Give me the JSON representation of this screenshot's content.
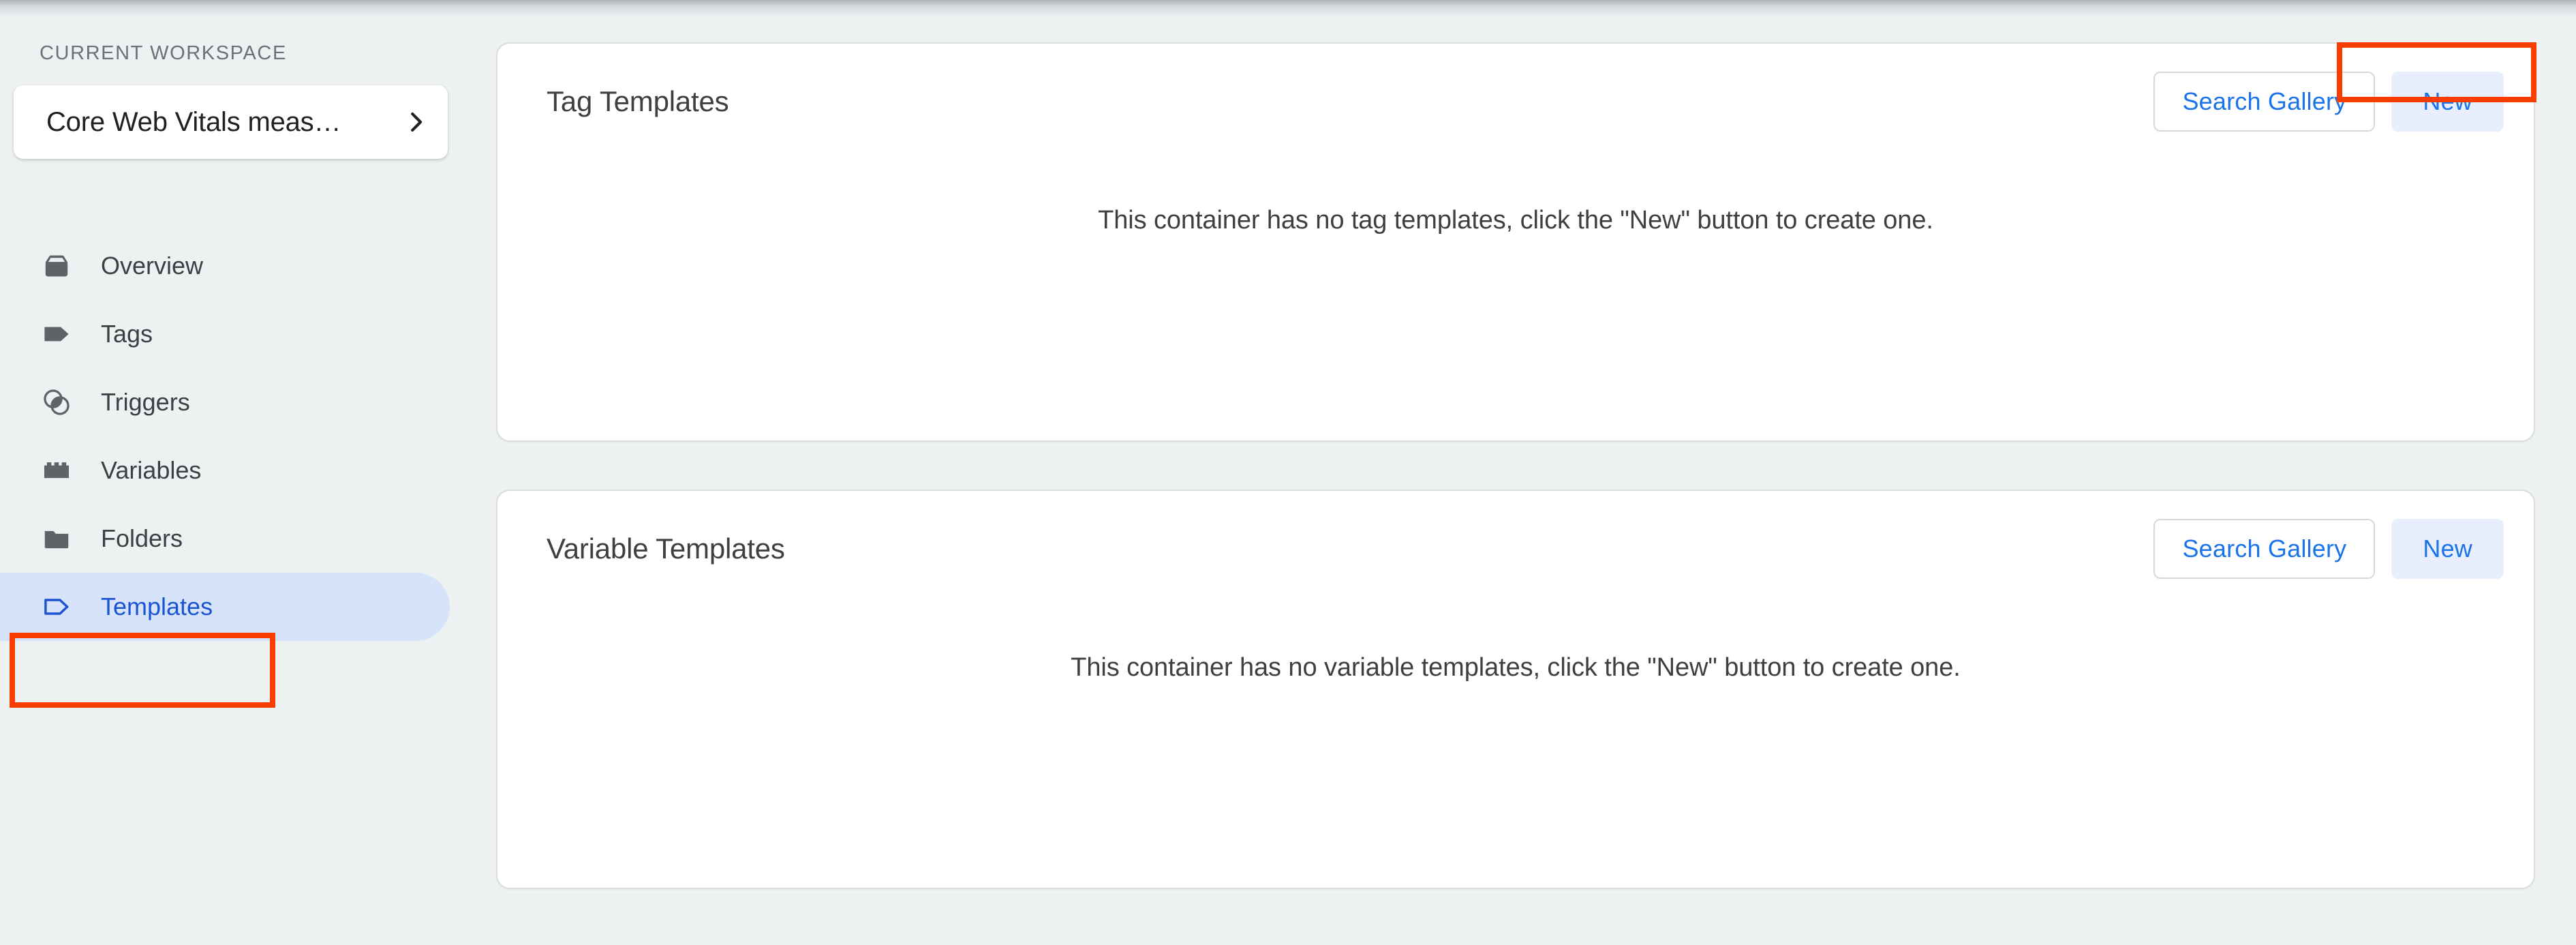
{
  "sidebar": {
    "workspace_label": "CURRENT WORKSPACE",
    "workspace_name": "Core Web Vitals meas…",
    "chevron_icon": "chevron-right-icon",
    "items": [
      {
        "label": "Overview",
        "icon": "container-box-icon",
        "active": false
      },
      {
        "label": "Tags",
        "icon": "tag-icon",
        "active": false
      },
      {
        "label": "Triggers",
        "icon": "overlapping-circles-icon",
        "active": false
      },
      {
        "label": "Variables",
        "icon": "brick-icon",
        "active": false
      },
      {
        "label": "Folders",
        "icon": "folder-icon",
        "active": false
      },
      {
        "label": "Templates",
        "icon": "tag-outline-icon",
        "active": true
      }
    ]
  },
  "main": {
    "cards": [
      {
        "title": "Tag Templates",
        "search_gallery_label": "Search Gallery",
        "new_label": "New",
        "empty_message": "This container has no tag templates, click the \"New\" button to create one."
      },
      {
        "title": "Variable Templates",
        "search_gallery_label": "Search Gallery",
        "new_label": "New",
        "empty_message": "This container has no variable templates, click the \"New\" button to create one."
      }
    ]
  },
  "annotations": {
    "highlight_color": "#f93c00",
    "targets": [
      "sidebar-item-templates",
      "tag-templates-new-button"
    ]
  },
  "colors": {
    "page_background": "#eef1f2",
    "card_background": "#ffffff",
    "card_border": "#dadce0",
    "accent_blue": "#1a73e8",
    "active_nav_background": "#d7e3fb",
    "active_nav_text": "#1b54d3",
    "icon_grey": "#5f6368",
    "tonal_button_background": "#e8eefb"
  }
}
